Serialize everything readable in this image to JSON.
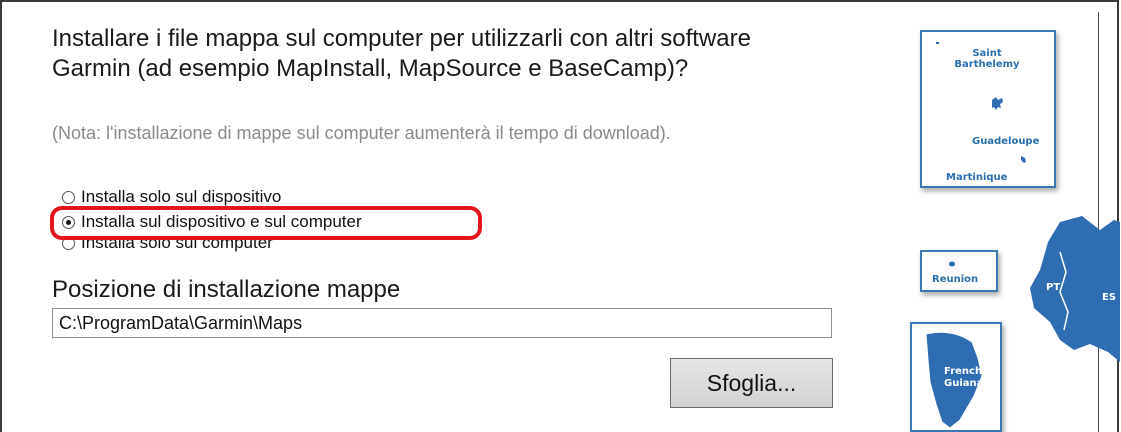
{
  "question": {
    "text": "Installare i file mappa sul computer per utilizzarli con altri software Garmin (ad esempio MapInstall, MapSource e BaseCamp)?",
    "note": "(Nota: l'installazione di mappe sul computer aumenterà il tempo di download)."
  },
  "install_options": [
    {
      "label": "Installa solo sul dispositivo",
      "selected": false
    },
    {
      "label": "Installa sul dispositivo e sul computer",
      "selected": true
    },
    {
      "label": "Installa solo sul computer",
      "selected": false
    }
  ],
  "location": {
    "label": "Posizione di installazione mappe",
    "path_value": "C:\\ProgramData\\Garmin\\Maps",
    "browse_label": "Sfoglia..."
  },
  "map_labels": {
    "saint_barthelemy": "Saint Barthelemy",
    "guadeloupe": "Guadeloupe",
    "martinique": "Martinique",
    "reunion": "Reunion",
    "french_guiana": "French Guiana",
    "pt": "PT",
    "es": "ES"
  },
  "colors": {
    "highlight": "#e3141b",
    "map_blue": "#2f6db3",
    "map_text": "#2a6fae"
  }
}
